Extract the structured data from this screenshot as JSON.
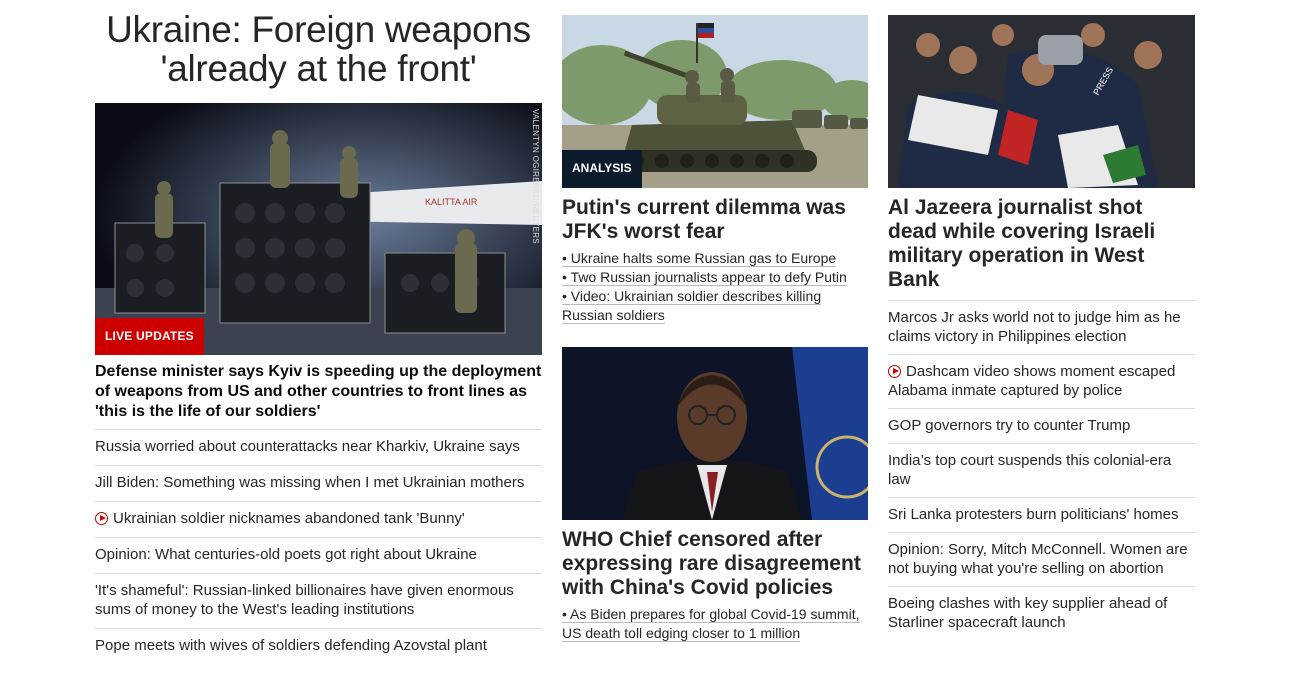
{
  "col1": {
    "headline": "Ukraine: Foreign weapons 'already at the front'",
    "photo_credit": "VALENTYN OGIRENKO/REUTERS",
    "plane_text": "KALITTA AIR",
    "badge": "LIVE UPDATES",
    "main_desc": "Defense minister says Kyiv is speeding up the deployment of weapons from US and other countries to front lines as 'this is the life of our soldiers'",
    "links": [
      {
        "text": "Russia worried about counterattacks near Kharkiv, Ukraine says"
      },
      {
        "text": "Jill Biden: Something was missing when I met Ukrainian mothers"
      },
      {
        "text": "Ukrainian soldier nicknames abandoned tank 'Bunny'",
        "video": true
      },
      {
        "text": "Opinion: What centuries-old poets got right about Ukraine"
      },
      {
        "text": "'It's shameful': Russian-linked billionaires have given enormous sums of money to the West's leading institutions"
      },
      {
        "text": "Pope meets with wives of soldiers defending Azovstal plant"
      }
    ]
  },
  "col2": {
    "story1": {
      "badge": "ANALYSIS",
      "headline": "Putin's current dilemma was JFK's worst fear",
      "bullets": [
        "• Ukraine halts some Russian gas to Europe",
        "• Two Russian journalists appear to defy Putin",
        "• Video: Ukrainian soldier describes killing Russian soldiers"
      ]
    },
    "story2": {
      "headline": "WHO Chief censored after expressing rare disagreement with China's Covid policies",
      "bullets": [
        "• As Biden prepares for global Covid-19 summit, US death toll edging closer to 1 million"
      ]
    }
  },
  "col3": {
    "headline": "Al Jazeera journalist shot dead while covering Israeli military operation in West Bank",
    "press_text": "PRESS",
    "links": [
      {
        "text": "Marcos Jr asks world not to judge him as he claims victory in Philippines election"
      },
      {
        "text": "Dashcam video shows moment escaped Alabama inmate captured by police",
        "video": true
      },
      {
        "text": "GOP governors try to counter Trump"
      },
      {
        "text": "India’s top court suspends this colonial-era law"
      },
      {
        "text": "Sri Lanka protesters burn politicians' homes"
      },
      {
        "text": "Opinion: Sorry, Mitch McConnell. Women are not buying what you're selling on abortion"
      },
      {
        "text": "Boeing clashes with key supplier ahead of Starliner spacecraft launch"
      }
    ]
  },
  "colors": {
    "live_badge": "#cc0000",
    "analysis_badge": "#0c1b2c",
    "video_icon": "#cc0000"
  }
}
